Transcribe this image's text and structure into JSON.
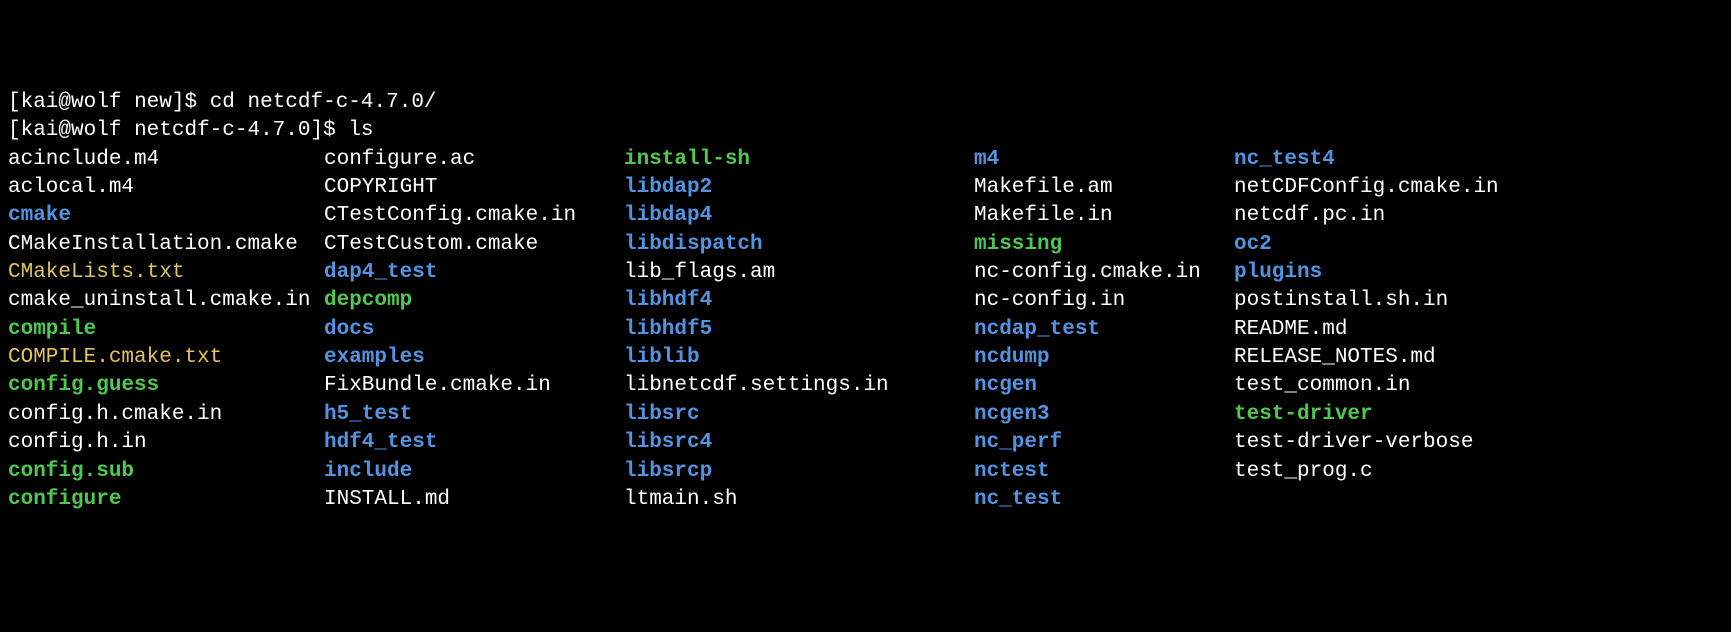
{
  "prompts": [
    {
      "user": "kai",
      "host": "wolf",
      "cwd": "new",
      "cmd": "cd netcdf-c-4.7.0/"
    },
    {
      "user": "kai",
      "host": "wolf",
      "cwd": "netcdf-c-4.7.0",
      "cmd": "ls"
    }
  ],
  "listing": {
    "rows": [
      [
        {
          "name": "acinclude.m4",
          "type": "file"
        },
        {
          "name": "configure.ac",
          "type": "file"
        },
        {
          "name": "install-sh",
          "type": "exec"
        },
        {
          "name": "m4",
          "type": "dir"
        },
        {
          "name": "nc_test4",
          "type": "dir"
        }
      ],
      [
        {
          "name": "aclocal.m4",
          "type": "file"
        },
        {
          "name": "COPYRIGHT",
          "type": "file"
        },
        {
          "name": "libdap2",
          "type": "dir"
        },
        {
          "name": "Makefile.am",
          "type": "file"
        },
        {
          "name": "netCDFConfig.cmake.in",
          "type": "file"
        }
      ],
      [
        {
          "name": "cmake",
          "type": "dir"
        },
        {
          "name": "CTestConfig.cmake.in",
          "type": "file"
        },
        {
          "name": "libdap4",
          "type": "dir"
        },
        {
          "name": "Makefile.in",
          "type": "file"
        },
        {
          "name": "netcdf.pc.in",
          "type": "file"
        }
      ],
      [
        {
          "name": "CMakeInstallation.cmake",
          "type": "file"
        },
        {
          "name": "CTestCustom.cmake",
          "type": "file"
        },
        {
          "name": "libdispatch",
          "type": "dir"
        },
        {
          "name": "missing",
          "type": "exec"
        },
        {
          "name": "oc2",
          "type": "dir"
        }
      ],
      [
        {
          "name": "CMakeLists.txt",
          "type": "special"
        },
        {
          "name": "dap4_test",
          "type": "dir"
        },
        {
          "name": "lib_flags.am",
          "type": "file"
        },
        {
          "name": "nc-config.cmake.in",
          "type": "file"
        },
        {
          "name": "plugins",
          "type": "dir"
        }
      ],
      [
        {
          "name": "cmake_uninstall.cmake.in",
          "type": "file"
        },
        {
          "name": "depcomp",
          "type": "exec"
        },
        {
          "name": "libhdf4",
          "type": "dir"
        },
        {
          "name": "nc-config.in",
          "type": "file"
        },
        {
          "name": "postinstall.sh.in",
          "type": "file"
        }
      ],
      [
        {
          "name": "compile",
          "type": "exec"
        },
        {
          "name": "docs",
          "type": "dir"
        },
        {
          "name": "libhdf5",
          "type": "dir"
        },
        {
          "name": "ncdap_test",
          "type": "dir"
        },
        {
          "name": "README.md",
          "type": "file"
        }
      ],
      [
        {
          "name": "COMPILE.cmake.txt",
          "type": "special"
        },
        {
          "name": "examples",
          "type": "dir"
        },
        {
          "name": "liblib",
          "type": "dir"
        },
        {
          "name": "ncdump",
          "type": "dir"
        },
        {
          "name": "RELEASE_NOTES.md",
          "type": "file"
        }
      ],
      [
        {
          "name": "config.guess",
          "type": "exec"
        },
        {
          "name": "FixBundle.cmake.in",
          "type": "file"
        },
        {
          "name": "libnetcdf.settings.in",
          "type": "file"
        },
        {
          "name": "ncgen",
          "type": "dir"
        },
        {
          "name": "test_common.in",
          "type": "file"
        }
      ],
      [
        {
          "name": "config.h.cmake.in",
          "type": "file"
        },
        {
          "name": "h5_test",
          "type": "dir"
        },
        {
          "name": "libsrc",
          "type": "dir"
        },
        {
          "name": "ncgen3",
          "type": "dir"
        },
        {
          "name": "test-driver",
          "type": "exec"
        }
      ],
      [
        {
          "name": "config.h.in",
          "type": "file"
        },
        {
          "name": "hdf4_test",
          "type": "dir"
        },
        {
          "name": "libsrc4",
          "type": "dir"
        },
        {
          "name": "nc_perf",
          "type": "dir"
        },
        {
          "name": "test-driver-verbose",
          "type": "file"
        }
      ],
      [
        {
          "name": "config.sub",
          "type": "exec"
        },
        {
          "name": "include",
          "type": "dir"
        },
        {
          "name": "libsrcp",
          "type": "dir"
        },
        {
          "name": "nctest",
          "type": "dir"
        },
        {
          "name": "test_prog.c",
          "type": "file"
        }
      ],
      [
        {
          "name": "configure",
          "type": "exec"
        },
        {
          "name": "INSTALL.md",
          "type": "file"
        },
        {
          "name": "ltmain.sh",
          "type": "file"
        },
        {
          "name": "nc_test",
          "type": "dir"
        },
        {
          "name": "",
          "type": "file"
        }
      ]
    ]
  }
}
